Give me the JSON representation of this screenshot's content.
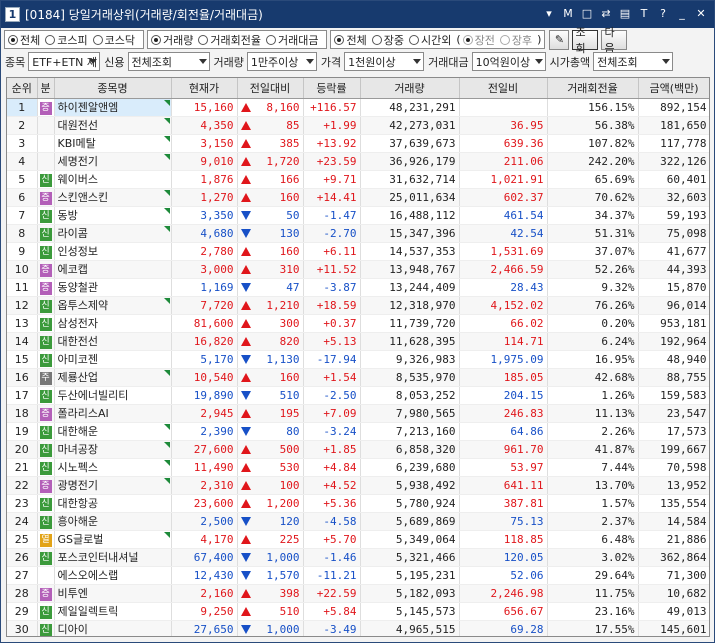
{
  "window": {
    "screen_no": "1",
    "title": "[0184] 당일거래상위(거래량/회전율/거래대금)"
  },
  "titlebar_icons": [
    "pin-icon",
    "notes-icon",
    "window-icon",
    "link-icon",
    "layout-icon",
    "font-icon",
    "help-icon",
    "minimize-icon",
    "close-icon"
  ],
  "titlebar_glyphs": [
    "▾",
    "M",
    "□",
    "⇄",
    "▤",
    "T",
    "?",
    "_",
    "✕"
  ],
  "market_filter": {
    "options": [
      "전체",
      "코스피",
      "코스닥"
    ],
    "selected": 0
  },
  "sort_filter": {
    "options": [
      "거래량",
      "거래회전율",
      "거래대금"
    ],
    "selected": 0
  },
  "session_filter": {
    "options": [
      "전체",
      "장중",
      "시간외"
    ],
    "selected": 0,
    "sub_options": [
      "장전",
      "장후"
    ],
    "sub_selected": 0,
    "paren_open": "(",
    "paren_close": ")"
  },
  "buttons": {
    "pin": "✎",
    "search": "조회",
    "next": "다음"
  },
  "filters": {
    "item_label": "종목",
    "item_value": "ETF+ETN 제",
    "credit_label": "신용",
    "credit_value": "전체조회",
    "volume_label": "거래량",
    "volume_value": "1만주이상",
    "price_label": "가격",
    "price_value": "1천원이상",
    "amount_label": "거래대금",
    "amount_value": "10억원이상",
    "mcap_label": "시가총액",
    "mcap_value": "전체조회"
  },
  "table": {
    "headers": [
      "순위",
      "분",
      "종목명",
      "현재가",
      "전일대비",
      "등락률",
      "거래량",
      "전일비",
      "거래회전율",
      "금액(백만)"
    ],
    "badge_colors": {
      "증": "#b35fb8",
      "신": "#3b9a3b",
      "주": "#777777",
      "열": "#e2a317"
    },
    "rows": [
      {
        "rank": "1",
        "badge": "증",
        "name": "하이젠알앤엠",
        "price": "15,160",
        "dir": "up",
        "chg": "8,160",
        "rate": "+116.57",
        "vol": "48,231,291",
        "prev": "",
        "turn": "156.15%",
        "amt": "892,154",
        "flag": true
      },
      {
        "rank": "2",
        "badge": "",
        "name": "대원전선",
        "price": "4,350",
        "dir": "up",
        "chg": "85",
        "rate": "+1.99",
        "vol": "42,273,031",
        "prev": "36.95",
        "turn": "56.38%",
        "amt": "181,650",
        "flag": true
      },
      {
        "rank": "3",
        "badge": "",
        "name": "KBI메탈",
        "price": "3,150",
        "dir": "up",
        "chg": "385",
        "rate": "+13.92",
        "vol": "37,639,673",
        "prev": "639.36",
        "turn": "107.82%",
        "amt": "117,778",
        "flag": true
      },
      {
        "rank": "4",
        "badge": "",
        "name": "세명전기",
        "price": "9,010",
        "dir": "up",
        "chg": "1,720",
        "rate": "+23.59",
        "vol": "36,926,179",
        "prev": "211.06",
        "turn": "242.20%",
        "amt": "322,126",
        "flag": true
      },
      {
        "rank": "5",
        "badge": "신",
        "name": "웨이버스",
        "price": "1,876",
        "dir": "up",
        "chg": "166",
        "rate": "+9.71",
        "vol": "31,632,714",
        "prev": "1,021.91",
        "turn": "65.69%",
        "amt": "60,401",
        "flag": false
      },
      {
        "rank": "6",
        "badge": "증",
        "name": "스킨앤스킨",
        "price": "1,270",
        "dir": "up",
        "chg": "160",
        "rate": "+14.41",
        "vol": "25,011,634",
        "prev": "602.37",
        "turn": "70.62%",
        "amt": "32,603",
        "flag": true
      },
      {
        "rank": "7",
        "badge": "신",
        "name": "동방",
        "price": "3,350",
        "dir": "dn",
        "chg": "50",
        "rate": "-1.47",
        "vol": "16,488,112",
        "prev": "461.54",
        "turn": "34.37%",
        "amt": "59,193",
        "flag": true
      },
      {
        "rank": "8",
        "badge": "신",
        "name": "라이콤",
        "price": "4,680",
        "dir": "dn",
        "chg": "130",
        "rate": "-2.70",
        "vol": "15,347,396",
        "prev": "42.54",
        "turn": "51.31%",
        "amt": "75,098",
        "flag": true
      },
      {
        "rank": "9",
        "badge": "신",
        "name": "인성정보",
        "price": "2,780",
        "dir": "up",
        "chg": "160",
        "rate": "+6.11",
        "vol": "14,537,353",
        "prev": "1,531.69",
        "turn": "37.07%",
        "amt": "41,677",
        "flag": false
      },
      {
        "rank": "10",
        "badge": "증",
        "name": "에코캡",
        "price": "3,000",
        "dir": "up",
        "chg": "310",
        "rate": "+11.52",
        "vol": "13,948,767",
        "prev": "2,466.59",
        "turn": "52.26%",
        "amt": "44,393",
        "flag": false
      },
      {
        "rank": "11",
        "badge": "증",
        "name": "동양철관",
        "price": "1,169",
        "dir": "dn",
        "chg": "47",
        "rate": "-3.87",
        "vol": "13,244,409",
        "prev": "28.43",
        "turn": "9.32%",
        "amt": "15,870",
        "flag": false
      },
      {
        "rank": "12",
        "badge": "신",
        "name": "옵투스제약",
        "price": "7,720",
        "dir": "up",
        "chg": "1,210",
        "rate": "+18.59",
        "vol": "12,318,970",
        "prev": "4,152.02",
        "turn": "76.26%",
        "amt": "96,014",
        "flag": true
      },
      {
        "rank": "13",
        "badge": "신",
        "name": "삼성전자",
        "price": "81,600",
        "dir": "up",
        "chg": "300",
        "rate": "+0.37",
        "vol": "11,739,720",
        "prev": "66.02",
        "turn": "0.20%",
        "amt": "953,181",
        "flag": false
      },
      {
        "rank": "14",
        "badge": "신",
        "name": "대한전선",
        "price": "16,820",
        "dir": "up",
        "chg": "820",
        "rate": "+5.13",
        "vol": "11,628,395",
        "prev": "114.71",
        "turn": "6.24%",
        "amt": "192,964",
        "flag": false
      },
      {
        "rank": "15",
        "badge": "신",
        "name": "아미코젠",
        "price": "5,170",
        "dir": "dn",
        "chg": "1,130",
        "rate": "-17.94",
        "vol": "9,326,983",
        "prev": "1,975.09",
        "turn": "16.95%",
        "amt": "48,940",
        "flag": false
      },
      {
        "rank": "16",
        "badge": "주",
        "name": "제룡산업",
        "price": "10,540",
        "dir": "up",
        "chg": "160",
        "rate": "+1.54",
        "vol": "8,535,970",
        "prev": "185.05",
        "turn": "42.68%",
        "amt": "88,755",
        "flag": true
      },
      {
        "rank": "17",
        "badge": "신",
        "name": "두산에너빌리티",
        "price": "19,890",
        "dir": "dn",
        "chg": "510",
        "rate": "-2.50",
        "vol": "8,053,252",
        "prev": "204.15",
        "turn": "1.26%",
        "amt": "159,583",
        "flag": false
      },
      {
        "rank": "18",
        "badge": "증",
        "name": "폴라리스AI",
        "price": "2,945",
        "dir": "up",
        "chg": "195",
        "rate": "+7.09",
        "vol": "7,980,565",
        "prev": "246.83",
        "turn": "11.13%",
        "amt": "23,547",
        "flag": false
      },
      {
        "rank": "19",
        "badge": "신",
        "name": "대한해운",
        "price": "2,390",
        "dir": "dn",
        "chg": "80",
        "rate": "-3.24",
        "vol": "7,213,160",
        "prev": "64.86",
        "turn": "2.26%",
        "amt": "17,573",
        "flag": true
      },
      {
        "rank": "20",
        "badge": "신",
        "name": "마녀공장",
        "price": "27,600",
        "dir": "up",
        "chg": "500",
        "rate": "+1.85",
        "vol": "6,858,320",
        "prev": "961.70",
        "turn": "41.87%",
        "amt": "199,667",
        "flag": true
      },
      {
        "rank": "21",
        "badge": "신",
        "name": "시노펙스",
        "price": "11,490",
        "dir": "up",
        "chg": "530",
        "rate": "+4.84",
        "vol": "6,239,680",
        "prev": "53.97",
        "turn": "7.44%",
        "amt": "70,598",
        "flag": true
      },
      {
        "rank": "22",
        "badge": "증",
        "name": "광명전기",
        "price": "2,310",
        "dir": "up",
        "chg": "100",
        "rate": "+4.52",
        "vol": "5,938,492",
        "prev": "641.11",
        "turn": "13.70%",
        "amt": "13,952",
        "flag": true
      },
      {
        "rank": "23",
        "badge": "신",
        "name": "대한항공",
        "price": "23,600",
        "dir": "up",
        "chg": "1,200",
        "rate": "+5.36",
        "vol": "5,780,924",
        "prev": "387.81",
        "turn": "1.57%",
        "amt": "135,554",
        "flag": false
      },
      {
        "rank": "24",
        "badge": "신",
        "name": "흥아해운",
        "price": "2,500",
        "dir": "dn",
        "chg": "120",
        "rate": "-4.58",
        "vol": "5,689,869",
        "prev": "75.13",
        "turn": "2.37%",
        "amt": "14,584",
        "flag": false
      },
      {
        "rank": "25",
        "badge": "열",
        "name": "GS글로벌",
        "price": "4,170",
        "dir": "up",
        "chg": "225",
        "rate": "+5.70",
        "vol": "5,349,064",
        "prev": "118.85",
        "turn": "6.48%",
        "amt": "21,886",
        "flag": true
      },
      {
        "rank": "26",
        "badge": "신",
        "name": "포스코인터내셔널",
        "price": "67,400",
        "dir": "dn",
        "chg": "1,000",
        "rate": "-1.46",
        "vol": "5,321,466",
        "prev": "120.05",
        "turn": "3.02%",
        "amt": "362,864",
        "flag": false
      },
      {
        "rank": "27",
        "badge": "",
        "name": "에스오에스랩",
        "price": "12,430",
        "dir": "dn",
        "chg": "1,570",
        "rate": "-11.21",
        "vol": "5,195,231",
        "prev": "52.06",
        "turn": "29.64%",
        "amt": "71,300",
        "flag": false
      },
      {
        "rank": "28",
        "badge": "증",
        "name": "비투엔",
        "price": "2,160",
        "dir": "up",
        "chg": "398",
        "rate": "+22.59",
        "vol": "5,182,093",
        "prev": "2,246.98",
        "turn": "11.75%",
        "amt": "10,682",
        "flag": false
      },
      {
        "rank": "29",
        "badge": "신",
        "name": "제일일렉트릭",
        "price": "9,250",
        "dir": "up",
        "chg": "510",
        "rate": "+5.84",
        "vol": "5,145,573",
        "prev": "656.67",
        "turn": "23.16%",
        "amt": "49,013",
        "flag": false
      },
      {
        "rank": "30",
        "badge": "신",
        "name": "디아이",
        "price": "27,650",
        "dir": "dn",
        "chg": "1,000",
        "rate": "-3.49",
        "vol": "4,965,515",
        "prev": "69.28",
        "turn": "17.55%",
        "amt": "145,601",
        "flag": false
      }
    ]
  }
}
